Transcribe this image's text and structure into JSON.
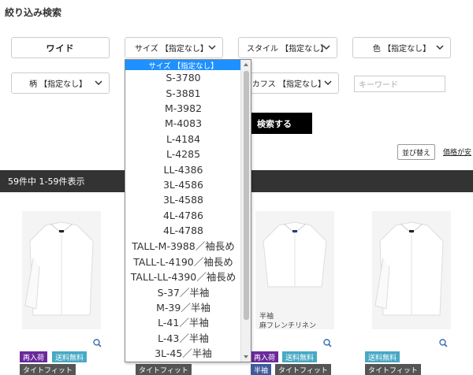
{
  "heading": "絞り込み検索",
  "filters": {
    "wide": "ワイド",
    "size": "サイズ 【指定なし】",
    "style": "スタイル 【指定なし】",
    "color": "色 【指定なし】",
    "pattern": "柄 【指定なし】",
    "cuffs": "袖・カフス 【指定なし】",
    "keyword_placeholder": "キーワード"
  },
  "search_button": "検索する",
  "sort_button": "並び替え",
  "price_link": "価格が安",
  "results_text": "59件中 1-59件表示",
  "dropdown": {
    "selected": "サイズ 【指定なし】",
    "options": [
      "S-3780",
      "S-3881",
      "M-3982",
      "M-4083",
      "L-4184",
      "L-4285",
      "LL-4386",
      "3L-4586",
      "3L-4588",
      "4L-4786",
      "4L-4788",
      "TALL-M-3988／袖長め",
      "TALL-L-4190／袖長め",
      "TALL-LL-4390／袖長め",
      "S-37／半袖",
      "M-39／半袖",
      "L-41／半袖",
      "L-43／半袖",
      "3L-45／半袖"
    ]
  },
  "products": [
    {
      "badges": [
        "再入荷",
        "送料無料"
      ],
      "tag": "タイトフィット"
    },
    {
      "badges": [],
      "tag": "タイトフィット"
    },
    {
      "badges": [
        "再入荷",
        "送料無料"
      ],
      "tag_1": "半袖",
      "tag_2": "タイトフィット",
      "caption_line1": "半袖",
      "caption_line2": "麻フレンチリネン"
    },
    {
      "badges": [
        "送料無料"
      ],
      "tag": "タイトフィット"
    }
  ],
  "colors": {
    "selected_bg": "#1e90ff",
    "bar_bg": "#333333",
    "badge_purple": "#6a2a9b",
    "badge_teal": "#48a9c5"
  }
}
